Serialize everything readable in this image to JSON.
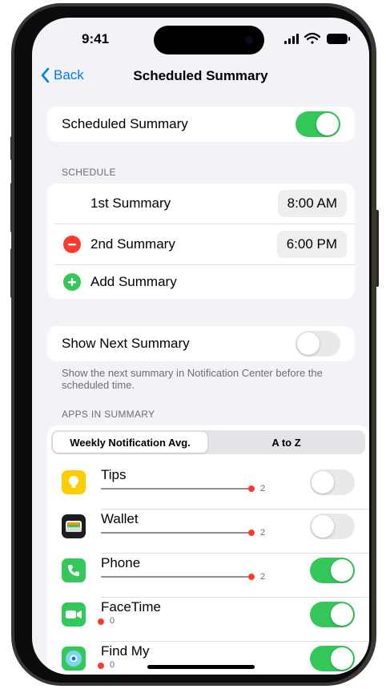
{
  "status_bar": {
    "time": "9:41"
  },
  "nav": {
    "back_label": "Back",
    "title": "Scheduled Summary"
  },
  "scheduled_summary": {
    "label": "Scheduled Summary",
    "enabled": true
  },
  "schedule": {
    "header": "SCHEDULE",
    "items": [
      {
        "label": "1st Summary",
        "time": "8:00 AM"
      },
      {
        "label": "2nd Summary",
        "time": "6:00 PM",
        "removable": true
      }
    ],
    "add_label": "Add Summary"
  },
  "show_next": {
    "label": "Show Next Summary",
    "enabled": false,
    "footer": "Show the next summary in Notification Center before the scheduled time."
  },
  "apps": {
    "header": "APPS IN SUMMARY",
    "segments": [
      "Weekly Notification Avg.",
      "A to Z"
    ],
    "selected_segment": "Weekly Notification Avg.",
    "list": [
      {
        "name": "Tips",
        "count": "2",
        "enabled": false,
        "icon": "tips-icon",
        "color": "#ffcc00"
      },
      {
        "name": "Wallet",
        "count": "2",
        "enabled": false,
        "icon": "wallet-icon",
        "color": "#1c1c1e"
      },
      {
        "name": "Phone",
        "count": "2",
        "enabled": true,
        "icon": "phone-icon",
        "color": "#34c759"
      },
      {
        "name": "FaceTime",
        "count": "0",
        "enabled": true,
        "icon": "facetime-icon",
        "color": "#34c759"
      },
      {
        "name": "Find My",
        "count": "0",
        "enabled": true,
        "icon": "find-my-icon",
        "color": "#34c759"
      }
    ]
  },
  "colors": {
    "accent": "#007aff",
    "toggle_on": "#34c759",
    "destructive": "#ff3b30",
    "background": "#f2f2f7"
  }
}
